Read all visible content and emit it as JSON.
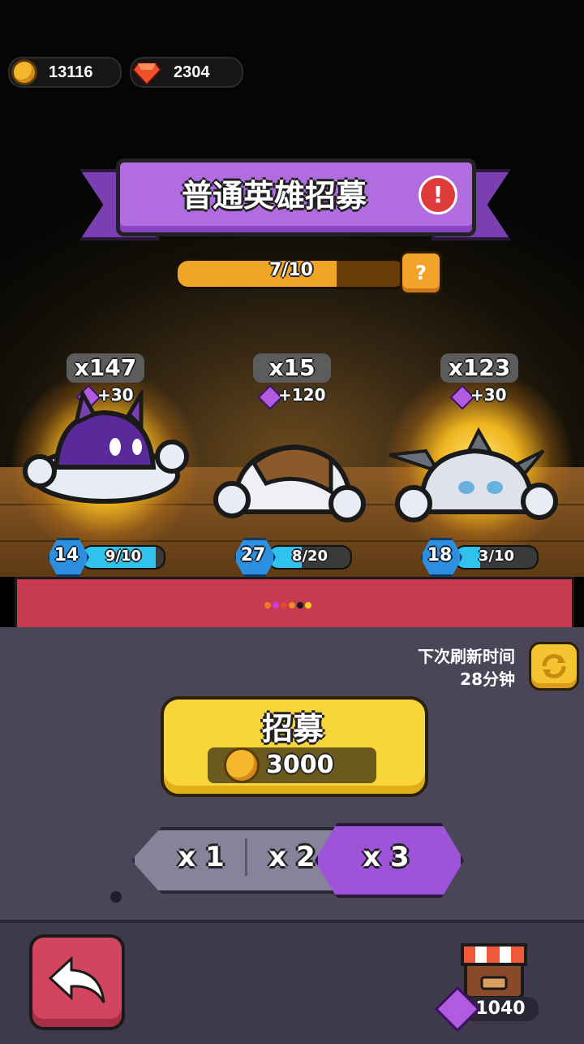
{
  "currency": {
    "coins": "13116",
    "gems": "2304"
  },
  "banner": {
    "title": "普通英雄招募",
    "alert_icon": "!"
  },
  "progress": {
    "text": "7/10",
    "value": 0.7,
    "help_icon": "?"
  },
  "heroes": [
    {
      "count": "x147",
      "bonus": "+30",
      "level": "14",
      "shards": "9/10",
      "shard_fraction": 0.9
    },
    {
      "count": "x15",
      "bonus": "+120",
      "level": "27",
      "shards": "8/20",
      "shard_fraction": 0.4
    },
    {
      "count": "x123",
      "bonus": "+30",
      "level": "18",
      "shards": "3/10",
      "shard_fraction": 0.3
    }
  ],
  "refresh": {
    "line1": "下次刷新时间",
    "line2": "28分钟"
  },
  "recruit": {
    "label": "招募",
    "cost": "3000"
  },
  "multipliers": {
    "options": [
      "x 1",
      "x 2",
      "x 3"
    ],
    "selected": "x 3"
  },
  "shop": {
    "gems": "1040"
  },
  "colors": {
    "accent_purple": "#9d54d8",
    "gold": "#f8d53a",
    "back_red": "#d2455e",
    "level_blue": "#2ec2ec"
  }
}
